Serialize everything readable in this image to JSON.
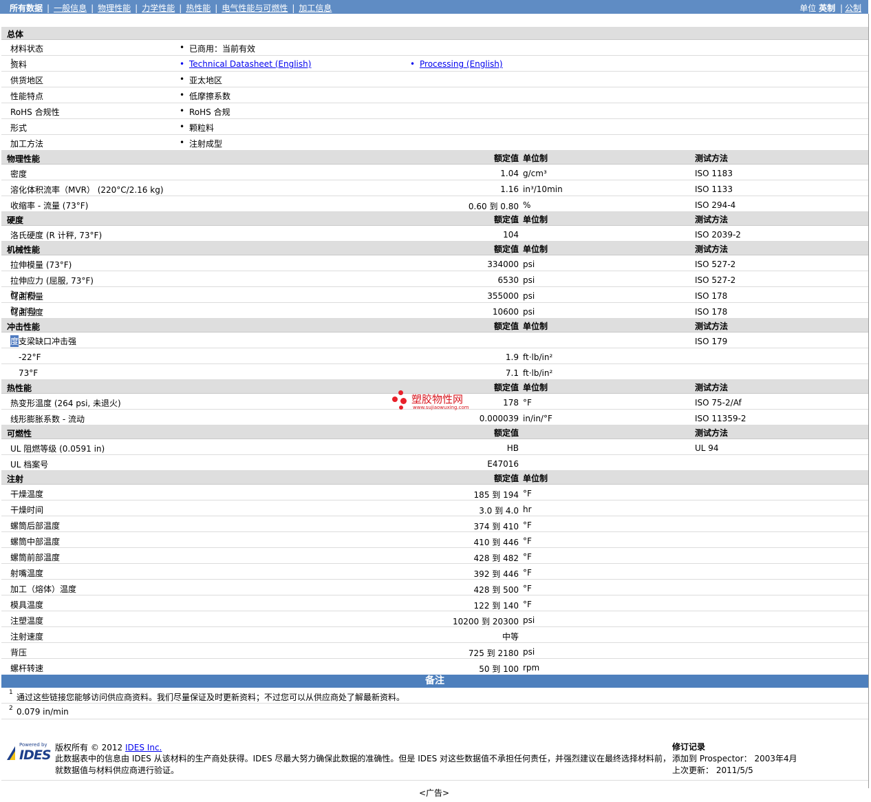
{
  "nav": {
    "all": "所有数据",
    "tabs": [
      "一般信息",
      "物理性能",
      "力学性能",
      "热性能",
      "电气性能与可燃性",
      "加工信息"
    ],
    "units_label": "单位",
    "unit_english": "英制",
    "unit_metric": "公制"
  },
  "general": {
    "title": "总体",
    "rows": [
      {
        "label": "材料状态",
        "value": "已商用：当前有效"
      },
      {
        "label": "资料",
        "note": "1",
        "link1": "Technical Datasheet (English)",
        "link2": "Processing (English)"
      },
      {
        "label": "供货地区",
        "value": "亚太地区"
      },
      {
        "label": "性能特点",
        "value": "低摩擦系数"
      },
      {
        "label": "RoHS 合规性",
        "value": "RoHS 合规"
      },
      {
        "label": "形式",
        "value": "颗粒料"
      },
      {
        "label": "加工方法",
        "value": "注射成型"
      }
    ]
  },
  "headers": {
    "nominal": "额定值",
    "unit": "单位制",
    "method": "测试方法"
  },
  "physical": {
    "title": "物理性能",
    "rows": [
      {
        "label": "密度",
        "value": "1.04",
        "unit": "g/cm³",
        "method": "ISO 1183"
      },
      {
        "label": "溶化体积流率（MVR） (220°C/2.16 kg)",
        "value": "1.16",
        "unit": "in³/10min",
        "method": "ISO 1133"
      },
      {
        "label": "收缩率 - 流量 (73°F)",
        "value": "0.60 到  0.80",
        "unit": "%",
        "method": "ISO 294-4"
      }
    ]
  },
  "hardness": {
    "title": "硬度",
    "rows": [
      {
        "label": "洛氏硬度 (R 计秤, 73°F)",
        "value": "104",
        "unit": "",
        "method": "ISO 2039-2"
      }
    ]
  },
  "mechanical": {
    "title": "机械性能",
    "rows": [
      {
        "label": "拉伸模量 (73°F)",
        "value": "334000",
        "unit": "psi",
        "method": "ISO 527-2"
      },
      {
        "label": "拉伸应力 (屈服, 73°F)",
        "value": "6530",
        "unit": "psi",
        "method": "ISO 527-2"
      },
      {
        "label": "弯曲模量",
        "note": "2",
        "suffix": " (73°F)",
        "value": "355000",
        "unit": "psi",
        "method": "ISO 178"
      },
      {
        "label": "弯曲强度",
        "note": "2",
        "suffix": " (73°F)",
        "value": "10600",
        "unit": "psi",
        "method": "ISO 178"
      }
    ]
  },
  "impact": {
    "title": "冲击性能",
    "label_a": "简支梁缺口冲击强",
    "label_b": "度",
    "method": "ISO 179",
    "rows": [
      {
        "label": "-22°F",
        "value": "1.9",
        "unit": "ft·lb/in²"
      },
      {
        "label": "73°F",
        "value": "7.1",
        "unit": "ft·lb/in²"
      }
    ]
  },
  "thermal": {
    "title": "热性能",
    "rows": [
      {
        "label": "热变形温度 (264 psi, 未退火)",
        "value": "178",
        "unit": "°F",
        "method": "ISO 75-2/Af"
      },
      {
        "label": "线形膨胀系数 - 流动",
        "value": "0.000039",
        "unit": "in/in/°F",
        "method": "ISO 11359-2"
      }
    ]
  },
  "flammability": {
    "title": "可燃性",
    "rows": [
      {
        "label": "UL 阻燃等级 (0.0591 in)",
        "value": "HB",
        "method": "UL 94"
      },
      {
        "label": "UL 档案号",
        "value": "E47016",
        "method": ""
      }
    ]
  },
  "injection": {
    "title": "注射",
    "rows": [
      {
        "label": "干燥温度",
        "value": "185 到  194",
        "unit": "°F"
      },
      {
        "label": "干燥时间",
        "value": "3.0 到  4.0",
        "unit": "hr"
      },
      {
        "label": "螺筒后部温度",
        "value": "374 到  410",
        "unit": "°F"
      },
      {
        "label": "螺筒中部温度",
        "value": "410 到  446",
        "unit": "°F"
      },
      {
        "label": "螺筒前部温度",
        "value": "428 到  482",
        "unit": "°F"
      },
      {
        "label": "射嘴温度",
        "value": "392 到  446",
        "unit": "°F"
      },
      {
        "label": "加工（熔体）温度",
        "value": "428 到  500",
        "unit": "°F"
      },
      {
        "label": "模具温度",
        "value": "122 到  140",
        "unit": "°F"
      },
      {
        "label": "注塑温度",
        "value": "10200 到  20300",
        "unit": "psi"
      },
      {
        "label": "注射速度",
        "value": "中等",
        "unit": ""
      },
      {
        "label": "背压",
        "value": "725 到  2180",
        "unit": "psi"
      },
      {
        "label": "螺杆转速",
        "value": "50 到  100",
        "unit": "rpm"
      }
    ]
  },
  "notes": {
    "title": "备注",
    "items": [
      {
        "num": "1",
        "text": "通过这些链接您能够访问供应商资料。我们尽量保证及时更新资料；不过您可以从供应商处了解最新资料。"
      },
      {
        "num": "2",
        "text": "0.079 in/min"
      }
    ]
  },
  "footer": {
    "powered": "Powered by",
    "logo": "IDES",
    "copyright": "版权所有  © 2012",
    "company_link": "IDES Inc.",
    "disclaimer1": "此数据表中的信息由  IDES 从该材料的生产商处获得。IDES 尽最大努力确保此数据的准确性。但是  IDES 对这些数据值不承担任何责任，并强烈建议在最终选择材料前，",
    "disclaimer2": "就数据值与材料供应商进行验证。",
    "rev_title": "修订记录",
    "rev_added": "添加到  Prospector：  2003年4月",
    "rev_updated": "上次更新：  2011/5/5",
    "ad": "<广告>"
  },
  "watermark": {
    "name": "塑胶物性网",
    "url": "www.sujiaowuxing.com"
  }
}
